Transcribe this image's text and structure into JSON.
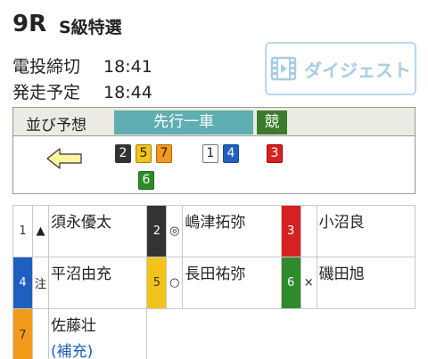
{
  "race": {
    "number": "9R",
    "grade": "S級特選"
  },
  "times": {
    "close_label": "電投締切",
    "close_time": "18:41",
    "start_label": "発走予定",
    "start_time": "18:44"
  },
  "digest_button": {
    "label": "ダイジェスト"
  },
  "prediction": {
    "title": "並び予想",
    "type": "先行一車",
    "mark": "競",
    "groups": [
      {
        "chips": [
          "2",
          "5",
          "7"
        ]
      },
      {
        "chips": [
          "1",
          "4"
        ]
      },
      {
        "chips": [
          "3"
        ]
      },
      {
        "chips": [
          "6"
        ]
      }
    ]
  },
  "entries": [
    {
      "num": "1",
      "mark": "▲",
      "name": "須永優太"
    },
    {
      "num": "2",
      "mark": "◎",
      "name": "嶋津拓弥"
    },
    {
      "num": "3",
      "mark": "",
      "name": "小沼良"
    },
    {
      "num": "4",
      "mark": "注",
      "name": "平沼由充"
    },
    {
      "num": "5",
      "mark": "○",
      "name": "長田祐弥"
    },
    {
      "num": "6",
      "mark": "×",
      "name": "磯田旭"
    },
    {
      "num": "7",
      "mark": "",
      "name": "佐藤壮",
      "note": "(補充)"
    }
  ],
  "colors": {
    "frame1": "#ffffff",
    "frame2": "#333333",
    "frame3": "#d42222",
    "frame4": "#1f5fc0",
    "frame5": "#f3c31d",
    "frame6": "#2f8a2c",
    "frame7": "#f29a1c",
    "tag": "#5eaeb2",
    "mark_bg": "#3a7c2c",
    "digest": "#a7cde3"
  },
  "icons": {
    "digest": "film-icon",
    "direction": "arrow-left-icon"
  }
}
